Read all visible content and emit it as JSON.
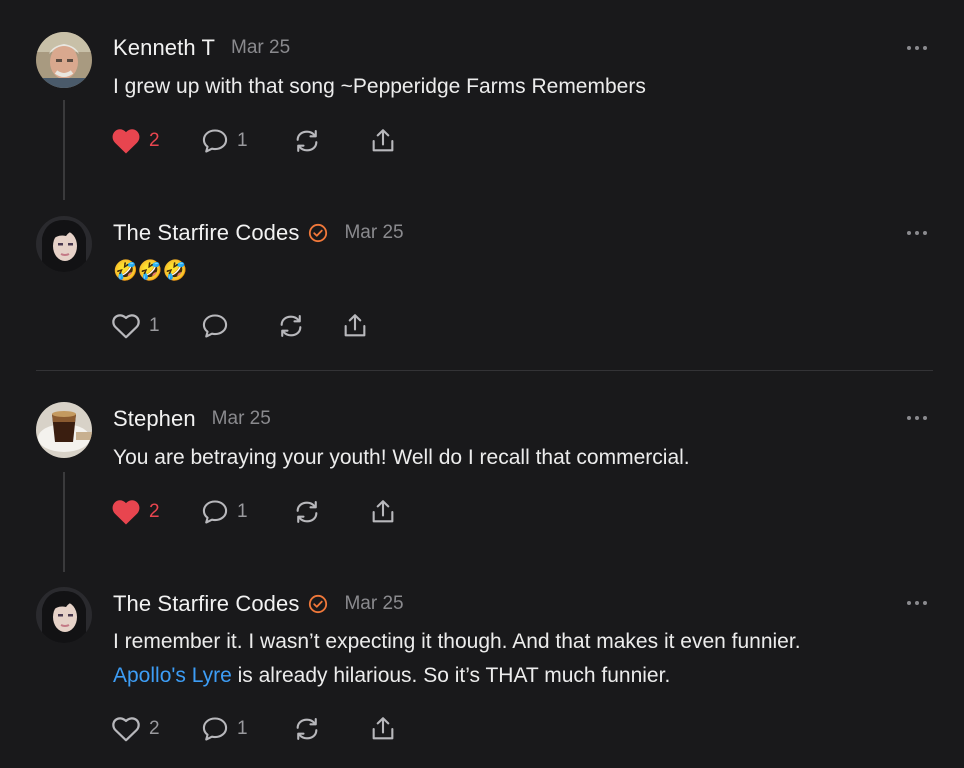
{
  "comments": [
    {
      "author": "Kenneth T",
      "date": "Mar 25",
      "verified": false,
      "text": "I grew up with that song ~Pepperidge Farms Remembers",
      "likes": "2",
      "liked": true,
      "replies": "1"
    },
    {
      "author": "The Starfire Codes",
      "date": "Mar 25",
      "verified": true,
      "text": "🤣🤣🤣",
      "likes": "1",
      "liked": false,
      "replies": ""
    },
    {
      "author": "Stephen",
      "date": "Mar 25",
      "verified": false,
      "text": "You are betraying your youth! Well do I recall that commercial.",
      "likes": "2",
      "liked": true,
      "replies": "1"
    },
    {
      "author": "The Starfire Codes",
      "date": "Mar 25",
      "verified": true,
      "text_line1": "I remember it. I wasn’t expecting it though. And that makes it even funnier.",
      "link_text": "Apollo's Lyre",
      "text_line2_rest": " is already hilarious. So it’s THAT much funnier.",
      "likes": "2",
      "liked": false,
      "replies": "1"
    }
  ],
  "colors": {
    "background": "#19191b",
    "liked": "#e8454f",
    "link": "#3d9df5",
    "verified_badge": "#f0783a"
  },
  "icons": [
    "heart-icon",
    "comment-icon",
    "restack-icon",
    "share-icon",
    "more-icon",
    "verified-badge-icon"
  ]
}
